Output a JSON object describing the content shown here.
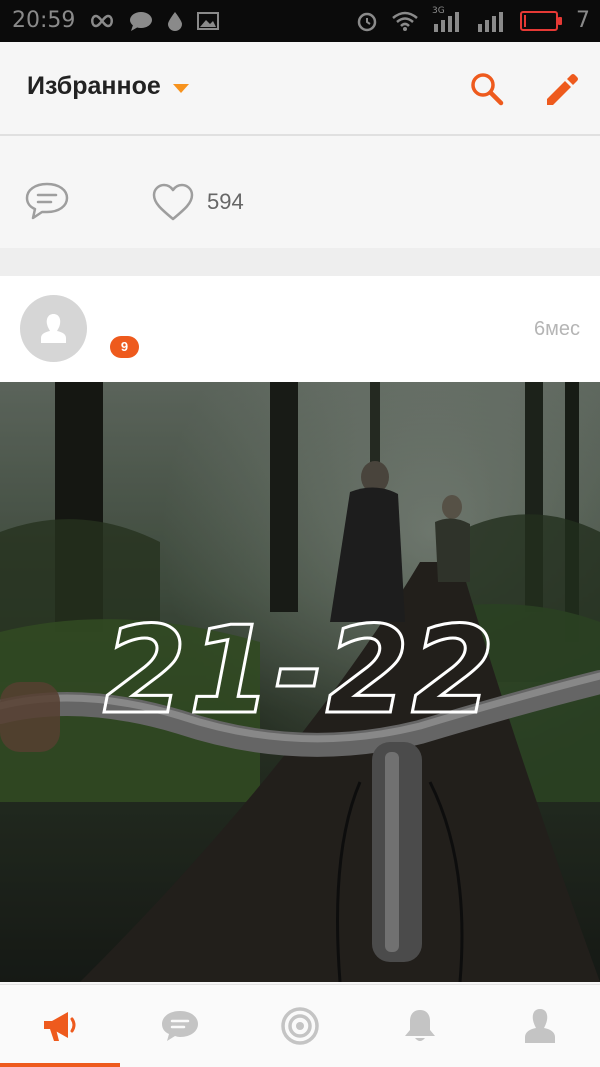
{
  "status_bar": {
    "time": "20:59",
    "battery_level": "7",
    "network": "3G",
    "left_icons": [
      "infinity-icon",
      "chat-bubble-icon",
      "drop-icon",
      "image-icon"
    ],
    "right_icons": [
      "alarm-icon",
      "wifi-icon",
      "signal-3g-icon",
      "signal-icon",
      "battery-icon"
    ]
  },
  "toolbar": {
    "title": "Избранное",
    "icons": [
      "dropdown-caret-icon",
      "search-icon",
      "edit-pencil-icon"
    ]
  },
  "previous_post": {
    "like_count": "594",
    "icons": [
      "comment-icon",
      "heart-icon"
    ]
  },
  "post": {
    "time_ago": "6мес",
    "badge_count": "9",
    "image_text": "21-22"
  },
  "bottom_nav": {
    "items": [
      {
        "icon": "megaphone-icon",
        "active": true
      },
      {
        "icon": "messages-icon",
        "active": false
      },
      {
        "icon": "discussions-target-icon",
        "active": false
      },
      {
        "icon": "notifications-bell-icon",
        "active": false
      },
      {
        "icon": "profile-icon",
        "active": false
      }
    ]
  },
  "colors": {
    "accent": "#ee5a1d",
    "caret": "#f7931e",
    "inactive_icon": "#c4c4c4",
    "status_bar": "#0b0b0b"
  }
}
